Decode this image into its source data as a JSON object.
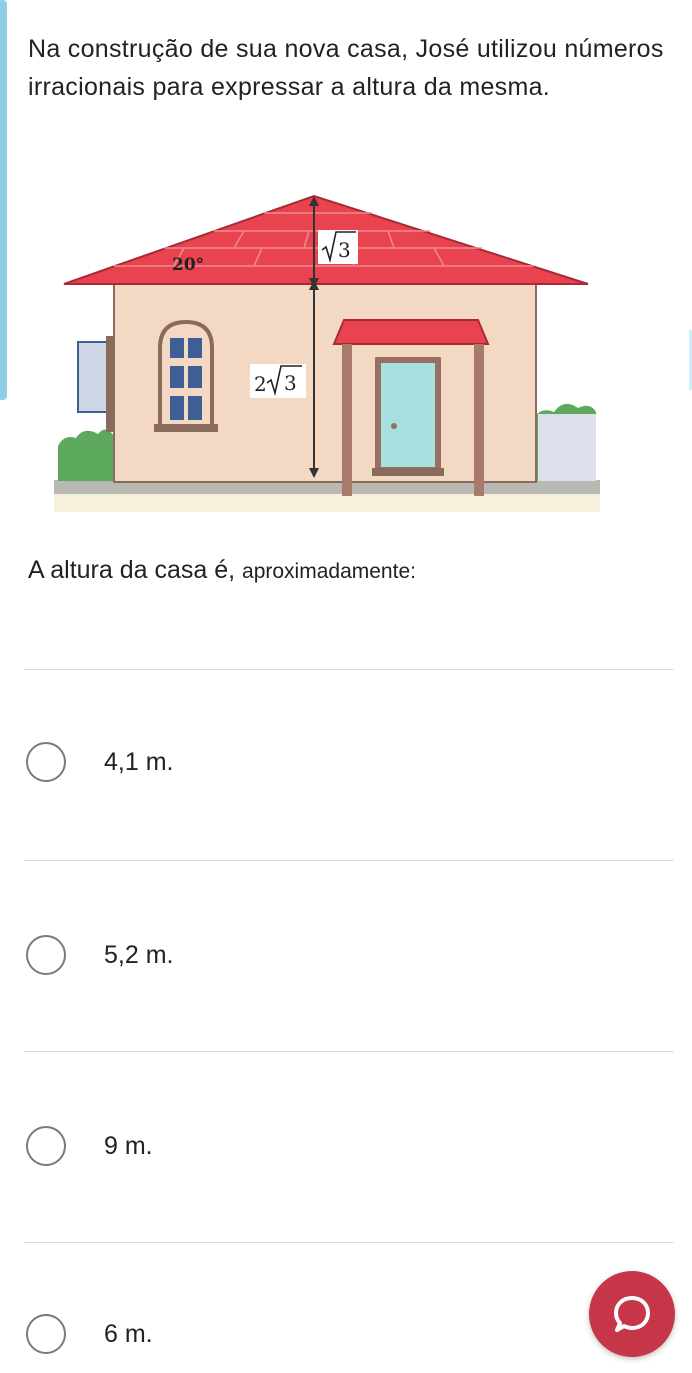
{
  "question": {
    "text": "Na construção de sua nova casa, José utilizou números irracionais para expressar a altura da mesma."
  },
  "figure": {
    "labels": {
      "angle": "20°",
      "roof_height_coef": "",
      "roof_height_radicand": "3",
      "wall_height_coef": "2",
      "wall_height_radicand": "3"
    },
    "colors": {
      "roof": "#e8434f",
      "wall": "#f3d9c3",
      "door": "#a6e1e0",
      "window": "#3d5f95",
      "grass": "#5daa5e"
    }
  },
  "prompt": {
    "main": "A altura da casa é, ",
    "small": "aproximadamente:"
  },
  "options": [
    {
      "label": "4,1 m."
    },
    {
      "label": "5,2 m."
    },
    {
      "label": "9 m."
    },
    {
      "label": "6 m."
    }
  ],
  "chat_button": {
    "icon": "chat-bubble-icon"
  }
}
